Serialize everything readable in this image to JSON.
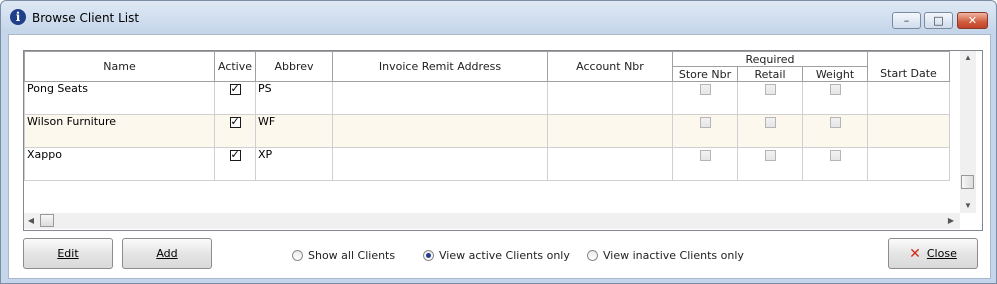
{
  "window": {
    "title": "Browse Client List",
    "minimize_glyph": "–",
    "maximize_glyph": "□",
    "close_glyph": "✕"
  },
  "grid": {
    "columns": {
      "name": "Name",
      "active": "Active",
      "abbrev": "Abbrev",
      "invoice_remit_address": "Invoice Remit Address",
      "account_nbr": "Account Nbr",
      "required_group": "Required",
      "store_nbr": "Store Nbr",
      "retail": "Retail",
      "weight": "Weight",
      "start_date": "Start Date"
    },
    "rows": [
      {
        "name": "Pong Seats",
        "active": true,
        "abbrev": "PS",
        "invoice_remit_address": "",
        "account_nbr": "",
        "store_nbr": false,
        "retail": false,
        "weight": false,
        "start_date": ""
      },
      {
        "name": "Wilson Furniture",
        "active": true,
        "abbrev": "WF",
        "invoice_remit_address": "",
        "account_nbr": "",
        "store_nbr": false,
        "retail": false,
        "weight": false,
        "start_date": ""
      },
      {
        "name": "Xappo",
        "active": true,
        "abbrev": "XP",
        "invoice_remit_address": "",
        "account_nbr": "",
        "store_nbr": false,
        "retail": false,
        "weight": false,
        "start_date": ""
      }
    ]
  },
  "buttons": {
    "edit": "Edit",
    "add": "Add",
    "close": "Close"
  },
  "filter": {
    "options": [
      {
        "label": "Show all Clients",
        "selected": false
      },
      {
        "label": "View active Clients only",
        "selected": true
      },
      {
        "label": "View inactive Clients only",
        "selected": false
      }
    ]
  },
  "colors": {
    "title_gradient": "#c6d6ea",
    "alt_row": "#fcf8ee",
    "close_icon": "#d12b1a"
  },
  "icons": {
    "app": "info-icon",
    "close_button": "red-x-icon"
  }
}
